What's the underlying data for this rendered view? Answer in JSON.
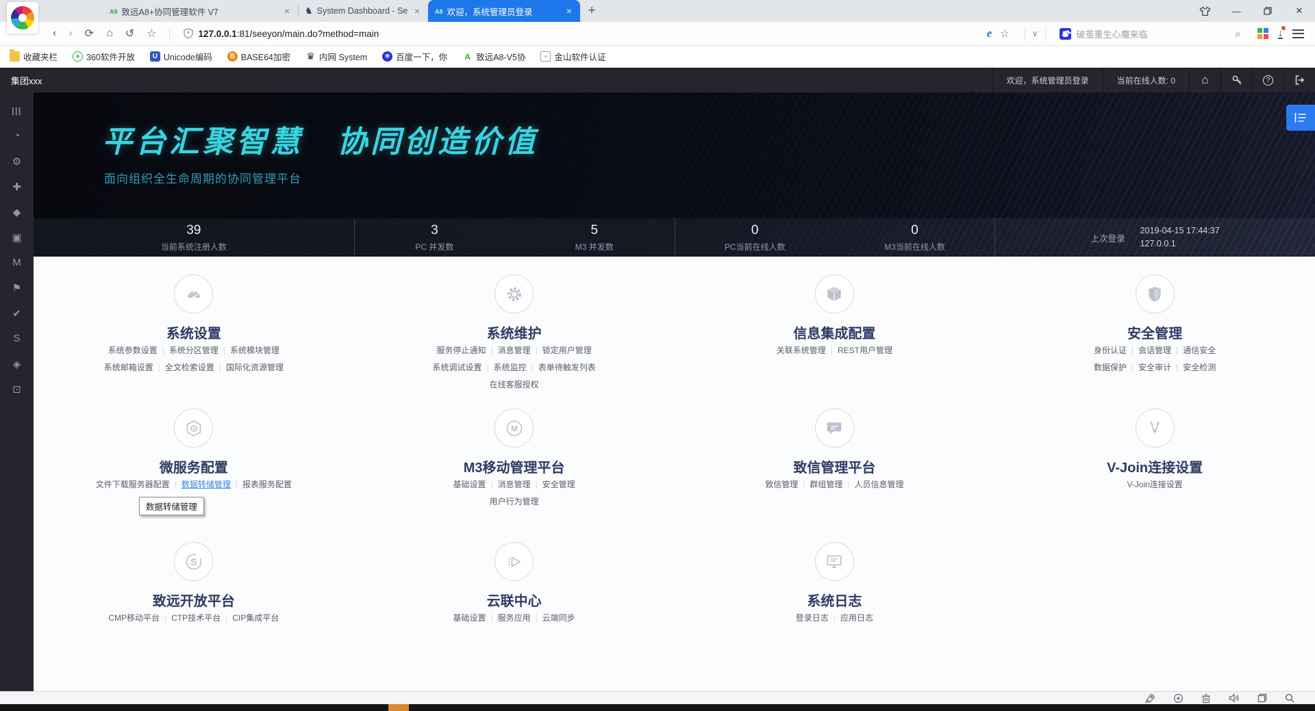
{
  "browser": {
    "tabs": [
      {
        "label": "致远A8+协同管理软件 V7",
        "favicon": "a8-favicon",
        "active": false
      },
      {
        "label": "System Dashboard - Se",
        "favicon": "dashboard-favicon",
        "active": false
      },
      {
        "label": "欢迎，系统管理员登录",
        "favicon": "a8-favicon",
        "active": true
      }
    ],
    "new_tab_glyph": "+",
    "address": {
      "host": "127.0.0.1",
      "path": ":81/seeyon/main.do?method=main"
    },
    "search_placeholder": "破茧重生心魔来临",
    "bookmarks": [
      {
        "label": "收藏夹栏",
        "icon": "folder-icon"
      },
      {
        "label": "360软件开放",
        "icon": "green-plus-icon"
      },
      {
        "label": "Unicode编码",
        "icon": "unicode-icon"
      },
      {
        "label": "BASE64加密",
        "icon": "base64-icon"
      },
      {
        "label": "内网 System",
        "icon": "system-icon"
      },
      {
        "label": "百度一下，你",
        "icon": "baidu-paw-icon"
      },
      {
        "label": "致远A8-V5协",
        "icon": "a8-icon"
      },
      {
        "label": "金山软件认证",
        "icon": "doc-icon"
      }
    ]
  },
  "app_header": {
    "org": "集团xxx",
    "welcome": "欢迎，系统管理员登录",
    "online": "当前在线人数: 0",
    "action_icons": [
      "home-icon",
      "key-icon",
      "help-icon",
      "logout-icon"
    ]
  },
  "sidebar": {
    "icons": [
      "columns-icon",
      "dashboard-icon",
      "gear-icon",
      "plugin-icon",
      "shield-icon",
      "package-icon",
      "m3-icon",
      "flag-icon",
      "check-icon",
      "open-platform-icon",
      "integration-icon",
      "monitor-icon"
    ]
  },
  "banner": {
    "title": "平台汇聚智慧　协同创造价值",
    "subtitle": "面向组织全生命周期的协同管理平台",
    "stats": [
      {
        "value": "39",
        "label": "当前系统注册人数"
      },
      {
        "value": "3",
        "label": "PC 并发数"
      },
      {
        "value": "5",
        "label": "M3 并发数"
      },
      {
        "value": "0",
        "label": "PC当前在线人数"
      },
      {
        "value": "0",
        "label": "M3当前在线人数"
      }
    ],
    "last_login": {
      "label": "上次登录",
      "time": "2019-04-15 17:44:37",
      "ip": "127.0.0.1"
    }
  },
  "modules": {
    "rows": [
      [
        {
          "title": "系统设置",
          "icon": "gauge-icon",
          "links": [
            [
              "系统参数设置",
              "系统分区管理",
              "系统模块管理"
            ],
            [
              "系统邮箱设置",
              "全文检索设置",
              "国际化资源管理"
            ]
          ]
        },
        {
          "title": "系统维护",
          "icon": "maintenance-gear-icon",
          "links": [
            [
              "服务停止通知",
              "消息管理",
              "锁定用户管理"
            ],
            [
              "系统调试设置",
              "系统监控",
              "表单待触发列表"
            ],
            [
              "在线客服授权"
            ]
          ]
        },
        {
          "title": "信息集成配置",
          "icon": "package-box-icon",
          "links": [
            [
              "关联系统管理",
              "REST用户管理"
            ]
          ]
        },
        {
          "title": "安全管理",
          "icon": "security-shield-icon",
          "links": [
            [
              "身份认证",
              "会话管理",
              "通信安全"
            ],
            [
              "数据保护",
              "安全审计",
              "安全检测"
            ]
          ]
        }
      ],
      [
        {
          "title": "微服务配置",
          "icon": "hexagon-service-icon",
          "links": [
            [
              "文件下载服务器配置",
              "数据转储管理",
              "报表服务配置"
            ]
          ],
          "active_link": "数据转储管理",
          "tooltip": "数据转储管理"
        },
        {
          "title": "M3移动管理平台",
          "icon": "m-circle-icon",
          "links": [
            [
              "基础设置",
              "消息管理",
              "安全管理"
            ],
            [
              "用户行为管理"
            ]
          ]
        },
        {
          "title": "致信管理平台",
          "icon": "chat-bubble-icon",
          "links": [
            [
              "致信管理",
              "群组管理",
              "人员信息管理"
            ]
          ]
        },
        {
          "title": "V-Join连接设置",
          "icon": "vjoin-icon",
          "links": [
            [
              "V-Join连接设置"
            ]
          ]
        }
      ],
      [
        {
          "title": "致远开放平台",
          "icon": "s-circle-icon",
          "links": [
            [
              "CMP移动平台",
              "CTP技术平台",
              "CIP集成平台"
            ]
          ]
        },
        {
          "title": "云联中心",
          "icon": "cloud-play-icon",
          "links": [
            [
              "基础设置",
              "服务应用",
              "云端同步"
            ]
          ]
        },
        {
          "title": "系统日志",
          "icon": "log-monitor-icon",
          "links": [
            [
              "登录日志",
              "应用日志"
            ]
          ]
        }
      ]
    ]
  },
  "bottom_bar": {
    "icons": [
      "rocket-icon",
      "speed-plus-icon",
      "trash-icon",
      "volume-icon",
      "window-icon",
      "search-icon"
    ]
  },
  "colors": {
    "accent_blue": "#1f78eb",
    "banner_cyan": "#38d4e1",
    "active_link_blue": "#3e86e0",
    "header_dark": "#26252d"
  }
}
